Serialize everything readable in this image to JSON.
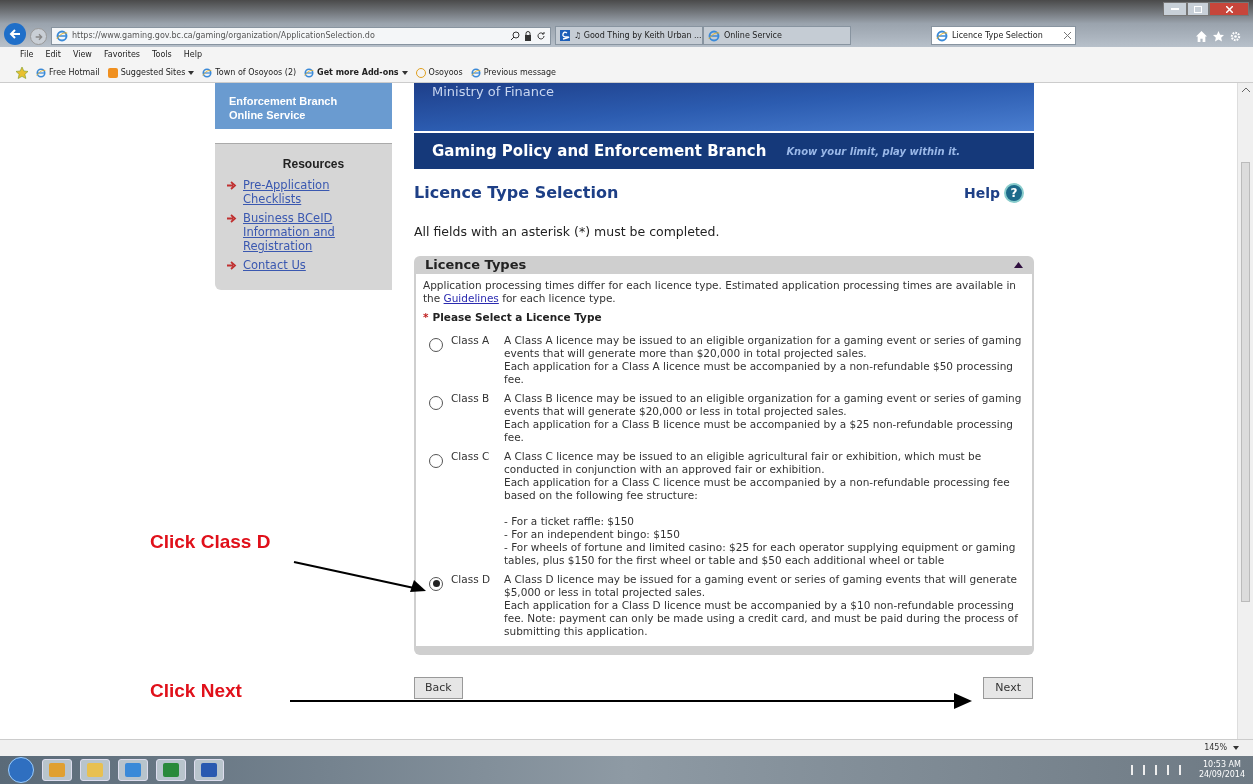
{
  "browser": {
    "address": "https://www.gaming.gov.bc.ca/gaming/organization/ApplicationSelection.do",
    "tabs": [
      {
        "label": "♫ Good Thing by Keith Urban ...",
        "selected": false
      },
      {
        "label": "Online Service",
        "selected": false
      },
      {
        "label": "Licence Type Selection",
        "selected": true
      }
    ],
    "menu": [
      "File",
      "Edit",
      "View",
      "Favorites",
      "Tools",
      "Help"
    ],
    "favorites": [
      {
        "label": "Free Hotmail",
        "bold": false,
        "dropdown": false
      },
      {
        "label": "Suggested Sites",
        "bold": false,
        "dropdown": true
      },
      {
        "label": "Town of Osoyoos (2)",
        "bold": false,
        "dropdown": false
      },
      {
        "label": "Get more Add-ons",
        "bold": true,
        "dropdown": true
      },
      {
        "label": "Osoyoos",
        "bold": false,
        "dropdown": false
      },
      {
        "label": "Previous message",
        "bold": false,
        "dropdown": false
      }
    ],
    "zoom": "145%"
  },
  "sidebar": {
    "header": [
      "Enforcement Branch",
      "Online Service"
    ],
    "title": "Resources",
    "links": [
      "Pre-Application Checklists",
      "Business BCeID Information and Registration",
      "Contact Us"
    ]
  },
  "banner": {
    "ministry": "Ministry of Finance",
    "branch": "Gaming Policy and Enforcement Branch",
    "slogan": "Know your limit, play within it."
  },
  "page": {
    "title": "Licence Type Selection",
    "help": "Help",
    "help_icon": "?",
    "required_note": "All fields with an asterisk (*) must be completed."
  },
  "panel": {
    "title": "Licence Types",
    "expanded": true,
    "intro_before": "Application processing times differ for each licence type. Estimated application processing times are available in the",
    "intro_link": "Guidelines",
    "intro_after": "for each licence type.",
    "required_mark": "*",
    "question": "Please Select a Licence Type",
    "options": [
      {
        "label": "Class A",
        "selected": false,
        "paragraphs": [
          "A Class A licence may be issued to an eligible organization for a gaming event or series of gaming events that will generate more than $20,000 in total projected sales.",
          "Each application for a Class A licence must be accompanied by a non-refundable $50 processing fee."
        ]
      },
      {
        "label": "Class B",
        "selected": false,
        "paragraphs": [
          "A Class B licence may be issued to an eligible organization for a gaming event or series of gaming events that will generate $20,000 or less in total projected sales.",
          "Each application for a Class B licence must be accompanied by a $25 non-refundable processing fee."
        ]
      },
      {
        "label": "Class C",
        "selected": false,
        "paragraphs": [
          "A Class C licence may be issued to an eligible agricultural fair or exhibition, which must be conducted in conjunction with an approved fair or exhibition.",
          "Each application for a Class C licence must be accompanied by a non-refundable processing fee based on the following fee structure:"
        ],
        "fees": [
          "- For a ticket raffle: $150",
          "- For an independent bingo: $150",
          "- For wheels of fortune and limited casino: $25 for each operator supplying equipment or gaming tables, plus $150 for the first wheel or table and $50 each additional wheel or table"
        ]
      },
      {
        "label": "Class D",
        "selected": true,
        "paragraphs": [
          "A Class D licence may be issued for a gaming event or series of gaming events that will generate $5,000 or less in total projected sales.",
          "Each application for a Class D licence must be accompanied by a $10 non-refundable processing fee. Note: payment can only be made using a credit card, and must be paid during the process of submitting this application."
        ]
      }
    ]
  },
  "buttons": {
    "back": "Back",
    "next": "Next"
  },
  "annotations": [
    {
      "text": "Click Class D"
    },
    {
      "text": "Click Next"
    }
  ],
  "taskbar": {
    "time": "10:53 AM",
    "date": "24/09/2014"
  }
}
